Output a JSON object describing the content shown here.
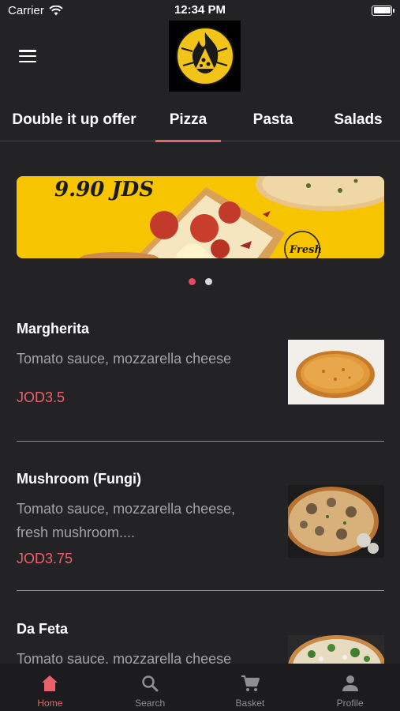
{
  "status": {
    "carrier": "Carrier",
    "time": "12:34 PM"
  },
  "header": {
    "menu_icon": "hamburger-icon",
    "logo": "pizza-flame-logo"
  },
  "tabs": [
    {
      "label": "Double it up offer",
      "active": false
    },
    {
      "label": "Pizza",
      "active": true
    },
    {
      "label": "Pasta",
      "active": false
    },
    {
      "label": "Salads",
      "active": false
    }
  ],
  "banner": {
    "text": "9.90 JDS",
    "badge_text": "Fresh",
    "page_count": 2,
    "active_page": 1
  },
  "items": [
    {
      "title": "Margherita",
      "description": "Tomato sauce, mozzarella cheese",
      "price": "JOD3.5"
    },
    {
      "title": "Mushroom (Fungi)",
      "description": "Tomato sauce, mozzarella cheese, fresh mushroom....",
      "price": "JOD3.75"
    },
    {
      "title": "Da Feta",
      "description": "Tomato sauce, mozzarella cheese",
      "price": ""
    }
  ],
  "tabbar": [
    {
      "label": "Home",
      "icon": "home-icon",
      "active": true
    },
    {
      "label": "Search",
      "icon": "search-icon",
      "active": false
    },
    {
      "label": "Basket",
      "icon": "cart-icon",
      "active": false
    },
    {
      "label": "Profile",
      "icon": "user-icon",
      "active": false
    }
  ],
  "colors": {
    "background": "#232326",
    "accent": "#e8616a",
    "banner": "#f7c500",
    "muted_text": "#a3a3a6"
  }
}
